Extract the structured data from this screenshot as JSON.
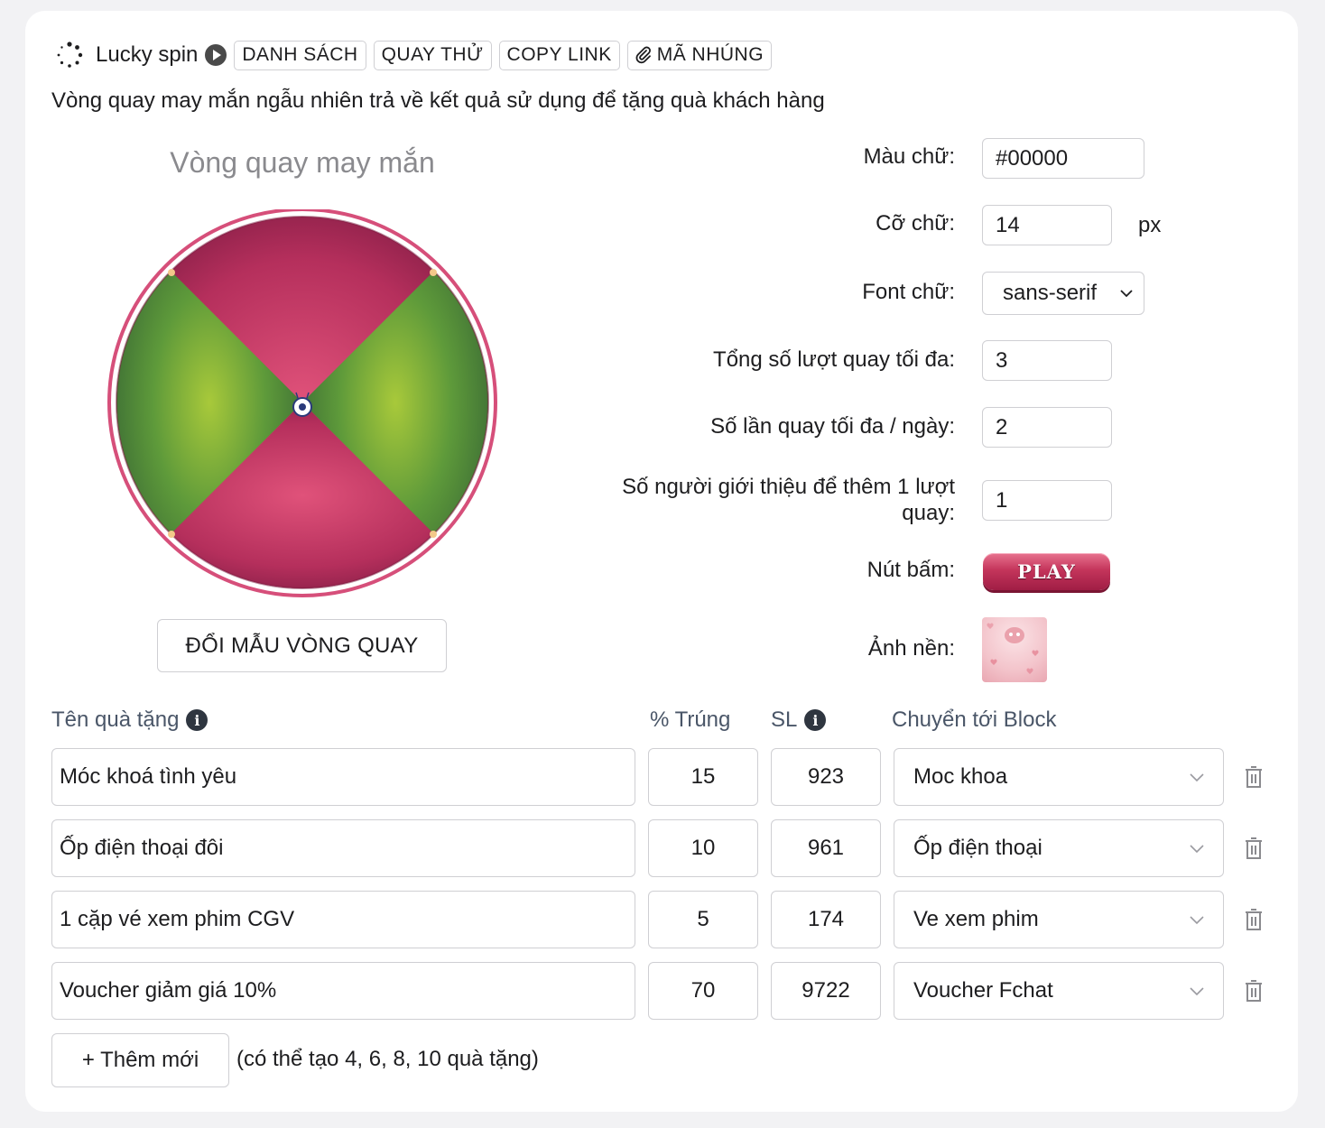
{
  "header": {
    "title": "Lucky spin",
    "buttons": {
      "list": "DANH SÁCH",
      "try_spin": "QUAY THỬ",
      "copy_link": "COPY LINK",
      "embed_code": "MÃ NHÚNG"
    },
    "icons": [
      "spinner-icon",
      "play-circle-icon",
      "paperclip-icon"
    ]
  },
  "description": "Vòng quay may mắn ngẫu nhiên trả về kết quả sử dụng để tặng quà khách hàng",
  "wheel": {
    "title": "Vòng quay may mắn",
    "change_button": "ĐỔI MẪU VÒNG QUAY",
    "colors": {
      "pink": "#c43c66",
      "green": "#5e9a3a",
      "rim": "#d64f7a"
    }
  },
  "settings": {
    "text_color": {
      "label": "Màu chữ:",
      "value": "#00000"
    },
    "font_size": {
      "label": "Cỡ chữ:",
      "value": "14",
      "unit": "px"
    },
    "font_family": {
      "label": "Font chữ:",
      "value": "sans-serif"
    },
    "max_total_spins": {
      "label": "Tổng số lượt quay tối đa:",
      "value": "3"
    },
    "max_spins_per_day": {
      "label": "Số lần quay tối đa / ngày:",
      "value": "2"
    },
    "referrals_per_spin": {
      "label": "Số người giới thiệu để thêm 1 lượt quay:",
      "value": "1"
    },
    "button": {
      "label": "Nút bấm:",
      "play_text": "PLAY"
    },
    "background": {
      "label": "Ảnh nền:"
    }
  },
  "table": {
    "headers": {
      "gift_name": "Tên quà tặng",
      "win_pct": "% Trúng",
      "quantity": "SL",
      "goto_block": "Chuyển tới Block"
    },
    "rows": [
      {
        "name": "Móc khoá tình yêu",
        "pct": "15",
        "qty": "923",
        "block": "Moc khoa"
      },
      {
        "name": "Ốp điện thoại đôi",
        "pct": "10",
        "qty": "961",
        "block": "Ốp điện thoại"
      },
      {
        "name": "1 cặp vé xem phim CGV",
        "pct": "5",
        "qty": "174",
        "block": "Ve xem phim"
      },
      {
        "name": "Voucher giảm giá 10%",
        "pct": "70",
        "qty": "9722",
        "block": "Voucher Fchat"
      }
    ]
  },
  "footer": {
    "add_button": "+ Thêm mới",
    "note": "(có thể tạo 4, 6, 8, 10 quà tặng)"
  }
}
